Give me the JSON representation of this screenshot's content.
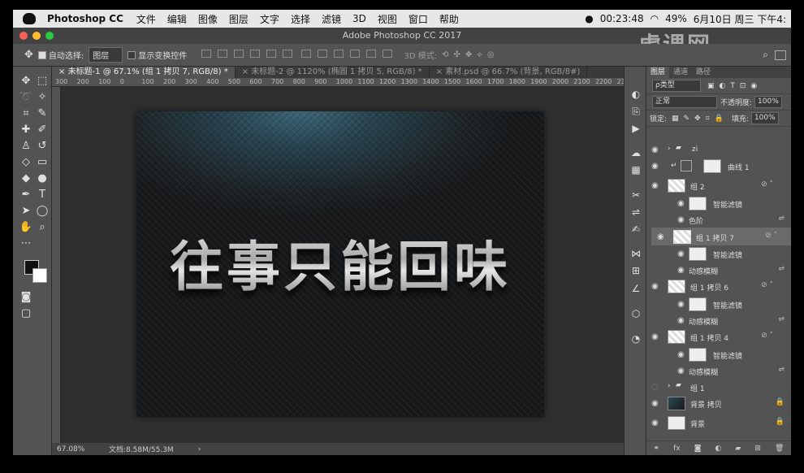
{
  "mac_menu": {
    "app": "Photoshop CC",
    "items": [
      "文件",
      "编辑",
      "图像",
      "图层",
      "文字",
      "选择",
      "滤镜",
      "3D",
      "视图",
      "窗口",
      "帮助"
    ],
    "time": "00:23:48",
    "battery": "49%",
    "date": "6月10日 周三 下午4:"
  },
  "window_title": "Adobe Photoshop CC 2017",
  "options": {
    "auto_select_label": "自动选择:",
    "auto_select_value": "图层",
    "transform_label": "显示变换控件",
    "mode3d_label": "3D 模式:"
  },
  "tabs": [
    "未标题-1 @ 67.1% (组 1 拷贝 7, RGB/8) *",
    "未标题-2 @ 1120% (椭圆 1 拷贝 5, RGB/8) *",
    "素材.psd @ 66.7% (背景, RGB/8#)"
  ],
  "ruler_ticks": [
    "300",
    "200",
    "100",
    "0",
    "100",
    "200",
    "300",
    "400",
    "500",
    "600",
    "700",
    "800",
    "900",
    "1000",
    "1100",
    "1200",
    "1300",
    "1400",
    "1500",
    "1600",
    "1700",
    "1800",
    "1900",
    "2000",
    "2100",
    "2200",
    "2300"
  ],
  "artwork_text": "往事只能回味",
  "status": {
    "zoom": "67.08%",
    "doc": "文档:8.58M/55.3M"
  },
  "layers_panel": {
    "tabs": [
      "图层",
      "通道",
      "路径"
    ],
    "filter_kind": "ρ类型",
    "blend_mode": "正常",
    "opacity_label": "不透明度:",
    "opacity": "100%",
    "lock_label": "锁定:",
    "fill_label": "填充:",
    "fill": "100%",
    "rows": [
      {
        "name": "zi",
        "type": "group"
      },
      {
        "name": "曲线 1",
        "type": "adjust"
      },
      {
        "name": "组 2",
        "type": "smart"
      },
      {
        "name": "智能滤镜",
        "type": "filter"
      },
      {
        "name": "色阶",
        "type": "fx"
      },
      {
        "name": "组 1 拷贝 7",
        "type": "smart"
      },
      {
        "name": "智能滤镜",
        "type": "filter"
      },
      {
        "name": "动感模糊",
        "type": "fx"
      },
      {
        "name": "组 1 拷贝 6",
        "type": "smart"
      },
      {
        "name": "智能滤镜",
        "type": "filter"
      },
      {
        "name": "动感模糊",
        "type": "fx"
      },
      {
        "name": "组 1 拷贝 4",
        "type": "smart"
      },
      {
        "name": "智能滤镜",
        "type": "filter"
      },
      {
        "name": "动感模糊",
        "type": "fx"
      },
      {
        "name": "组 1",
        "type": "group"
      },
      {
        "name": "背景 拷贝",
        "type": "bg"
      },
      {
        "name": "背景",
        "type": "bg"
      }
    ]
  }
}
